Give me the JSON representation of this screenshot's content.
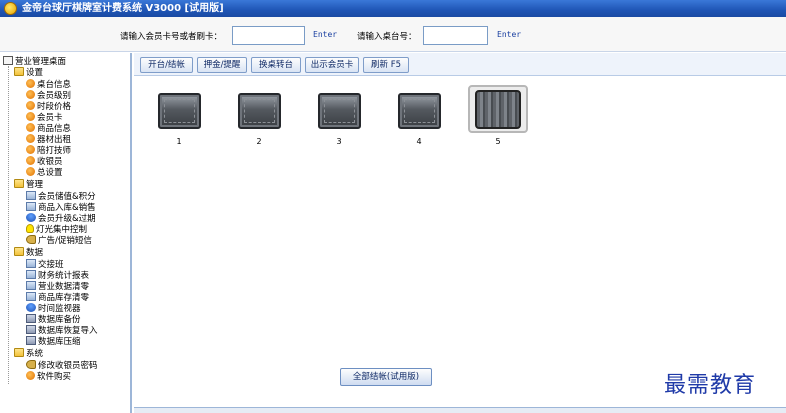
{
  "window": {
    "title": "金帝台球厅棋牌室计费系统 V3000 [试用版]"
  },
  "inputbar": {
    "card_label": "请输入会员卡号或者刷卡：",
    "card_value": "",
    "card_enter": "Enter",
    "table_label": "请输入桌台号：",
    "table_value": "",
    "table_enter": "Enter"
  },
  "sidebar": {
    "root": "营业管理桌面",
    "groups": [
      {
        "label": "设置",
        "items": [
          "桌台信息",
          "会员级别",
          "时段价格",
          "会员卡",
          "商品信息",
          "器材出租",
          "陪打技师",
          "收银员",
          "总设置"
        ]
      },
      {
        "label": "管理",
        "items": [
          "会员储值&积分",
          "商品入库&销售",
          "会员升级&过期",
          "灯光集中控制",
          "广告/促销短信"
        ]
      },
      {
        "label": "数据",
        "items": [
          "交接班",
          "财务统计报表",
          "营业数据清零",
          "商品库存清零",
          "时间监视器",
          "数据库备份",
          "数据库恢复导入",
          "数据库压缩"
        ]
      },
      {
        "label": "系统",
        "items": [
          "修改收银员密码",
          "软件购买"
        ]
      }
    ]
  },
  "toolbar": {
    "open_settle": "开台/结帐",
    "deposit_remind": "押金/提醒",
    "change_table": "换桌转台",
    "sell_card": "出示会员卡",
    "refresh": "刷新 F5"
  },
  "tables": [
    {
      "number": "1",
      "status": "idle"
    },
    {
      "number": "2",
      "status": "idle"
    },
    {
      "number": "3",
      "status": "idle"
    },
    {
      "number": "4",
      "status": "idle"
    },
    {
      "number": "5",
      "status": "selected"
    }
  ],
  "footer": {
    "settle_all": "全部结帐(试用版)"
  },
  "watermark": "最需教育",
  "colors": {
    "titlebar": "#1f55b5",
    "button_text": "#102a66",
    "enter_text": "#1a3fa0",
    "watermark": "#1f3aa8"
  }
}
